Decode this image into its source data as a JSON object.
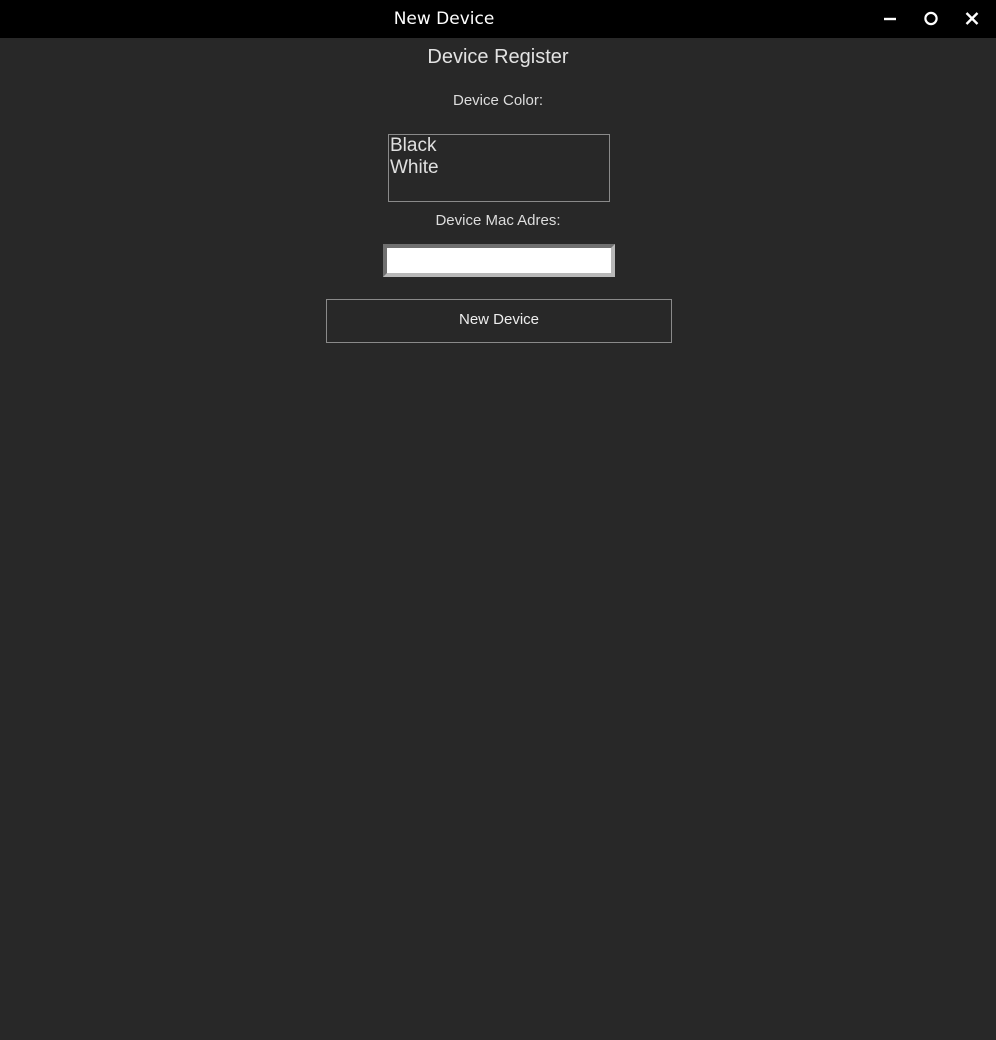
{
  "window": {
    "title": "New Device",
    "controls": {
      "minimize_icon": "minimize-icon",
      "maximize_icon": "maximize-icon",
      "close_icon": "close-icon"
    }
  },
  "form": {
    "heading": "Device Register",
    "color_label": "Device Color:",
    "color_options": [
      "Black",
      "White"
    ],
    "mac_label": "Device Mac Adres:",
    "mac_value": "",
    "submit_label": "New Device"
  },
  "colors": {
    "titlebar_bg": "#000000",
    "window_bg": "#282828",
    "text": "#e0e0e0",
    "border": "#8a8a8a",
    "entry_bg": "#ffffff"
  }
}
